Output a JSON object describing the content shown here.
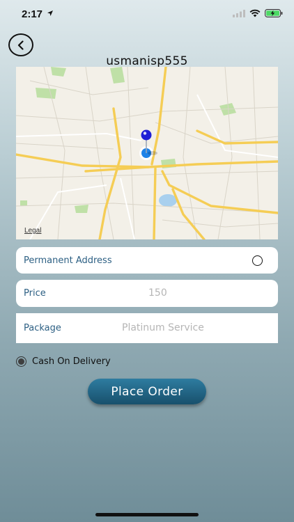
{
  "status_bar": {
    "time": "2:17",
    "icons": [
      "location-arrow-icon",
      "signal-icon",
      "wifi-icon",
      "battery-charging-icon"
    ]
  },
  "header": {
    "back_icon": "chevron-left-icon",
    "title": "usmanisp555"
  },
  "map": {
    "legal_label": "Legal",
    "pins": [
      "blue-pin",
      "user-location-dot"
    ]
  },
  "form": {
    "address": {
      "label": "Permanent Address",
      "icon": "radio-circle-icon"
    },
    "price": {
      "label": "Price",
      "value": "150"
    },
    "package": {
      "label": "Package",
      "value": "Platinum Service"
    }
  },
  "payment": {
    "label": "Cash On Delivery",
    "selected": true
  },
  "actions": {
    "place_order_label": "Place Order"
  },
  "colors": {
    "accent": "#1f6688",
    "label": "#2c5f83",
    "placeholder": "#b5b5b5"
  }
}
